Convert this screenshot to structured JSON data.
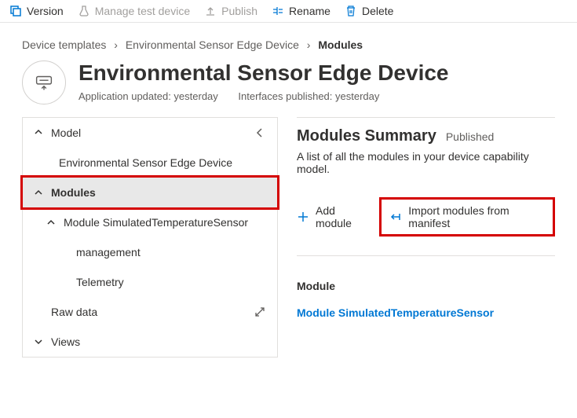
{
  "toolbar": {
    "version": "Version",
    "manage": "Manage test device",
    "publish": "Publish",
    "rename": "Rename",
    "delete": "Delete"
  },
  "breadcrumb": {
    "root": "Device templates",
    "device": "Environmental Sensor Edge Device",
    "current": "Modules"
  },
  "title": "Environmental Sensor Edge Device",
  "meta": {
    "updated": "Application updated: yesterday",
    "published": "Interfaces published: yesterday"
  },
  "tree": {
    "model": "Model",
    "device_name": "Environmental Sensor Edge Device",
    "modules": "Modules",
    "module_item": "Module SimulatedTemperatureSensor",
    "management": "management",
    "telemetry": "Telemetry",
    "raw_data": "Raw data",
    "views": "Views"
  },
  "summary": {
    "title": "Modules Summary",
    "status": "Published",
    "desc": "A list of all the modules in your device capability model.",
    "add": "Add module",
    "import": "Import modules from manifest",
    "section": "Module",
    "link": "Module SimulatedTemperatureSensor"
  }
}
